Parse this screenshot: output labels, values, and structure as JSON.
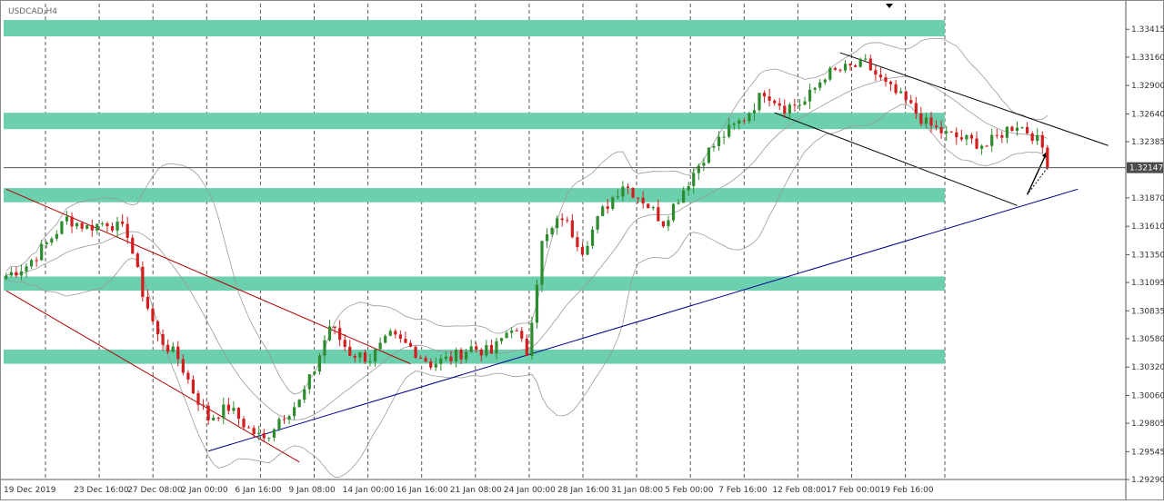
{
  "chart_data": {
    "type": "candlestick",
    "symbol_label": "USDCAD,H4",
    "current_price_label": "1.32147",
    "current_price": 1.32147,
    "ylim": [
      1.2929,
      1.3365
    ],
    "price_ticks": [
      "1.33415",
      "1.33160",
      "1.32900",
      "1.32640",
      "1.32385",
      "1.31870",
      "1.31610",
      "1.31350",
      "1.31095",
      "1.30835",
      "1.30580",
      "1.30320",
      "1.30060",
      "1.29805",
      "1.29545",
      "1.29290"
    ],
    "time_ticks": [
      "19 Dec 2019",
      "23 Dec 16:00",
      "27 Dec 08:00",
      "2 Jan 00:00",
      "6 Jan 16:00",
      "9 Jan 08:00",
      "14 Jan 00:00",
      "16 Jan 16:00",
      "21 Jan 08:00",
      "24 Jan 00:00",
      "28 Jan 16:00",
      "31 Jan 08:00",
      "5 Feb 00:00",
      "7 Feb 16:00",
      "12 Feb 08:00",
      "17 Feb 00:00",
      "19 Feb 16:00"
    ],
    "price_path": [
      [
        0,
        1.3116
      ],
      [
        4,
        1.3125
      ],
      [
        8,
        1.3145
      ],
      [
        12,
        1.3168
      ],
      [
        16,
        1.316
      ],
      [
        20,
        1.3165
      ],
      [
        24,
        1.3155
      ],
      [
        27,
        1.31
      ],
      [
        30,
        1.306
      ],
      [
        34,
        1.304
      ],
      [
        37,
        1.301
      ],
      [
        40,
        1.2985
      ],
      [
        44,
        1.2995
      ],
      [
        48,
        1.2975
      ],
      [
        51,
        1.2965
      ],
      [
        54,
        1.2985
      ],
      [
        58,
        1.3
      ],
      [
        61,
        1.303
      ],
      [
        64,
        1.307
      ],
      [
        68,
        1.3045
      ],
      [
        72,
        1.304
      ],
      [
        76,
        1.306
      ],
      [
        80,
        1.305
      ],
      [
        84,
        1.3035
      ],
      [
        88,
        1.304
      ],
      [
        92,
        1.305
      ],
      [
        96,
        1.3045
      ],
      [
        100,
        1.307
      ],
      [
        103,
        1.3045
      ],
      [
        106,
        1.3145
      ],
      [
        110,
        1.317
      ],
      [
        114,
        1.314
      ],
      [
        118,
        1.3175
      ],
      [
        122,
        1.32
      ],
      [
        126,
        1.3185
      ],
      [
        130,
        1.3165
      ],
      [
        134,
        1.3195
      ],
      [
        138,
        1.3225
      ],
      [
        142,
        1.3245
      ],
      [
        146,
        1.326
      ],
      [
        150,
        1.3285
      ],
      [
        154,
        1.327
      ],
      [
        158,
        1.3275
      ],
      [
        162,
        1.33
      ],
      [
        166,
        1.3305
      ],
      [
        170,
        1.331
      ],
      [
        174,
        1.329
      ],
      [
        178,
        1.3275
      ],
      [
        182,
        1.3255
      ],
      [
        186,
        1.3245
      ],
      [
        190,
        1.324
      ],
      [
        194,
        1.3235
      ],
      [
        198,
        1.325
      ],
      [
        200,
        1.3255
      ],
      [
        203,
        1.3245
      ],
      [
        206,
        1.3227
      ]
    ],
    "support_resistance_zones": [
      {
        "from": 1.3335,
        "to": 1.335
      },
      {
        "from": 1.325,
        "to": 1.3265
      },
      {
        "from": 1.3183,
        "to": 1.3196
      },
      {
        "from": 1.3102,
        "to": 1.3115
      },
      {
        "from": 1.3035,
        "to": 1.3048
      }
    ],
    "zone_color": "#6ccfae",
    "trendlines": [
      {
        "name": "blue-trendline",
        "color": "#00008b",
        "from": [
          40,
          1.2955
        ],
        "to": [
          212,
          1.3195
        ]
      },
      {
        "name": "red-channel-upper",
        "color": "#b00000",
        "from": [
          0,
          1.3195
        ],
        "to": [
          80,
          1.3035
        ]
      },
      {
        "name": "red-channel-lower",
        "color": "#b00000",
        "from": [
          0,
          1.3102
        ],
        "to": [
          58,
          1.2945
        ]
      },
      {
        "name": "black-channel-upper",
        "color": "#000000",
        "from": [
          165,
          1.332
        ],
        "to": [
          218,
          1.3235
        ]
      },
      {
        "name": "black-channel-lower",
        "color": "#000000",
        "from": [
          152,
          1.3265
        ],
        "to": [
          200,
          1.318
        ]
      }
    ],
    "forecast_arrow": {
      "from": [
        202,
        1.319
      ],
      "to": [
        206,
        1.323
      ]
    },
    "colors": {
      "bull": "#2e8b2e",
      "bear": "#d21e1e",
      "band": "#9a9a9a",
      "grid": "#555555",
      "current_price_line": "#555555"
    },
    "grid": "vertical dashed",
    "indicator": "Bollinger Bands"
  }
}
